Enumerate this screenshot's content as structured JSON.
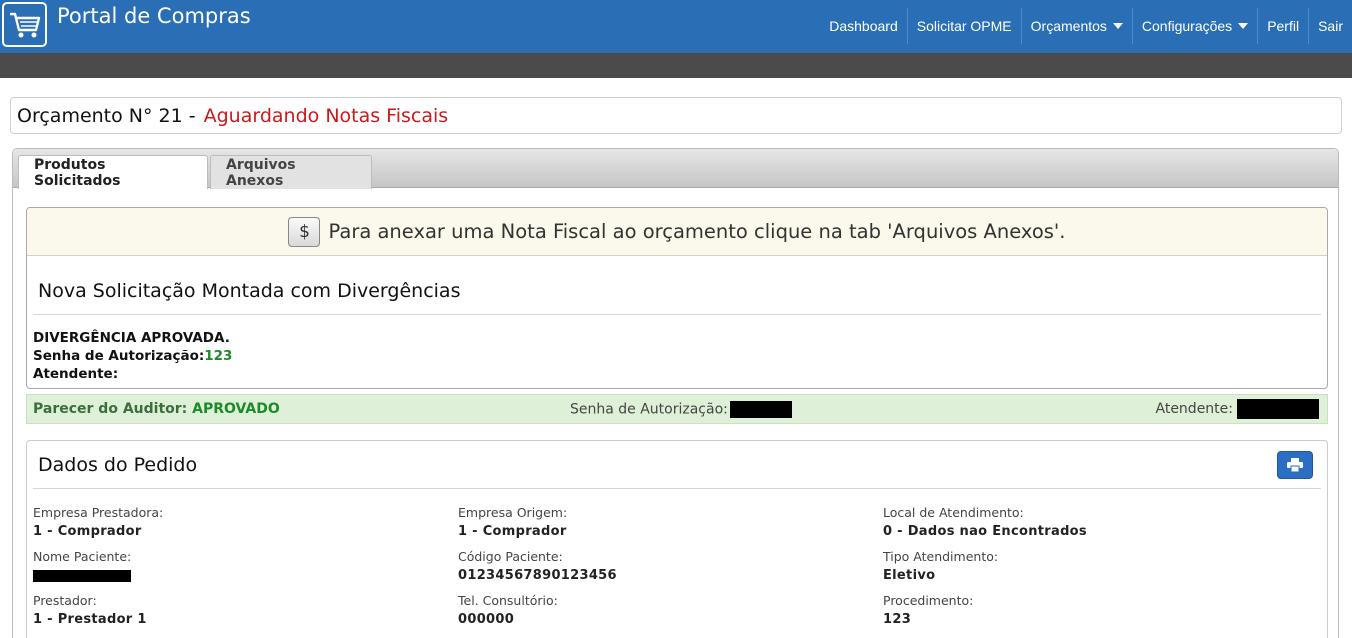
{
  "navbar": {
    "brand_title": "Portal de Compras",
    "items": [
      {
        "label": "Dashboard"
      },
      {
        "label": "Solicitar OPME"
      },
      {
        "label": "Orçamentos"
      },
      {
        "label": "Configurações"
      },
      {
        "label": "Perfil"
      },
      {
        "label": "Sair"
      }
    ]
  },
  "page": {
    "title_prefix": "Orçamento N° 21 -",
    "title_status": "Aguardando Notas Fiscais"
  },
  "tabs": [
    {
      "label": "Produtos Solicitados",
      "active": true
    },
    {
      "label": "Arquivos Anexos",
      "active": false
    }
  ],
  "alert": {
    "text": "Para anexar uma Nota Fiscal ao orçamento clique na tab 'Arquivos Anexos'."
  },
  "solicitacao": {
    "heading": "Nova Solicitação Montada com Divergências",
    "status_line": "DIVERGÊNCIA APROVADA.",
    "senha_label": "Senha de Autorização:",
    "senha_value": "123",
    "atendente_label": "Atendente:"
  },
  "parecer": {
    "label": "Parecer do Auditor:",
    "value": "APROVADO",
    "senha_label": "Senha de Autorização:",
    "atendente_label": "Atendente:"
  },
  "dados": {
    "title": "Dados do Pedido",
    "fields": [
      {
        "label": "Empresa Prestadora:",
        "value": "1 - Comprador"
      },
      {
        "label": "Empresa Origem:",
        "value": "1 - Comprador"
      },
      {
        "label": "Local de Atendimento:",
        "value": "0 - Dados nao Encontrados"
      },
      {
        "label": "Nome Paciente:",
        "value": ""
      },
      {
        "label": "Código Paciente:",
        "value": "01234567890123456"
      },
      {
        "label": "Tipo Atendimento:",
        "value": "Eletivo"
      },
      {
        "label": "Prestador:",
        "value": "1 - Prestador 1"
      },
      {
        "label": "Tel. Consultório:",
        "value": "000000"
      },
      {
        "label": "Procedimento:",
        "value": "123"
      }
    ]
  },
  "colors": {
    "navbar": "#2a6fb6",
    "status_red": "#cc1a1a",
    "success_green": "#1d8a2a",
    "success_bg": "#dff0d8",
    "alert_bg": "#fbf8ec"
  }
}
